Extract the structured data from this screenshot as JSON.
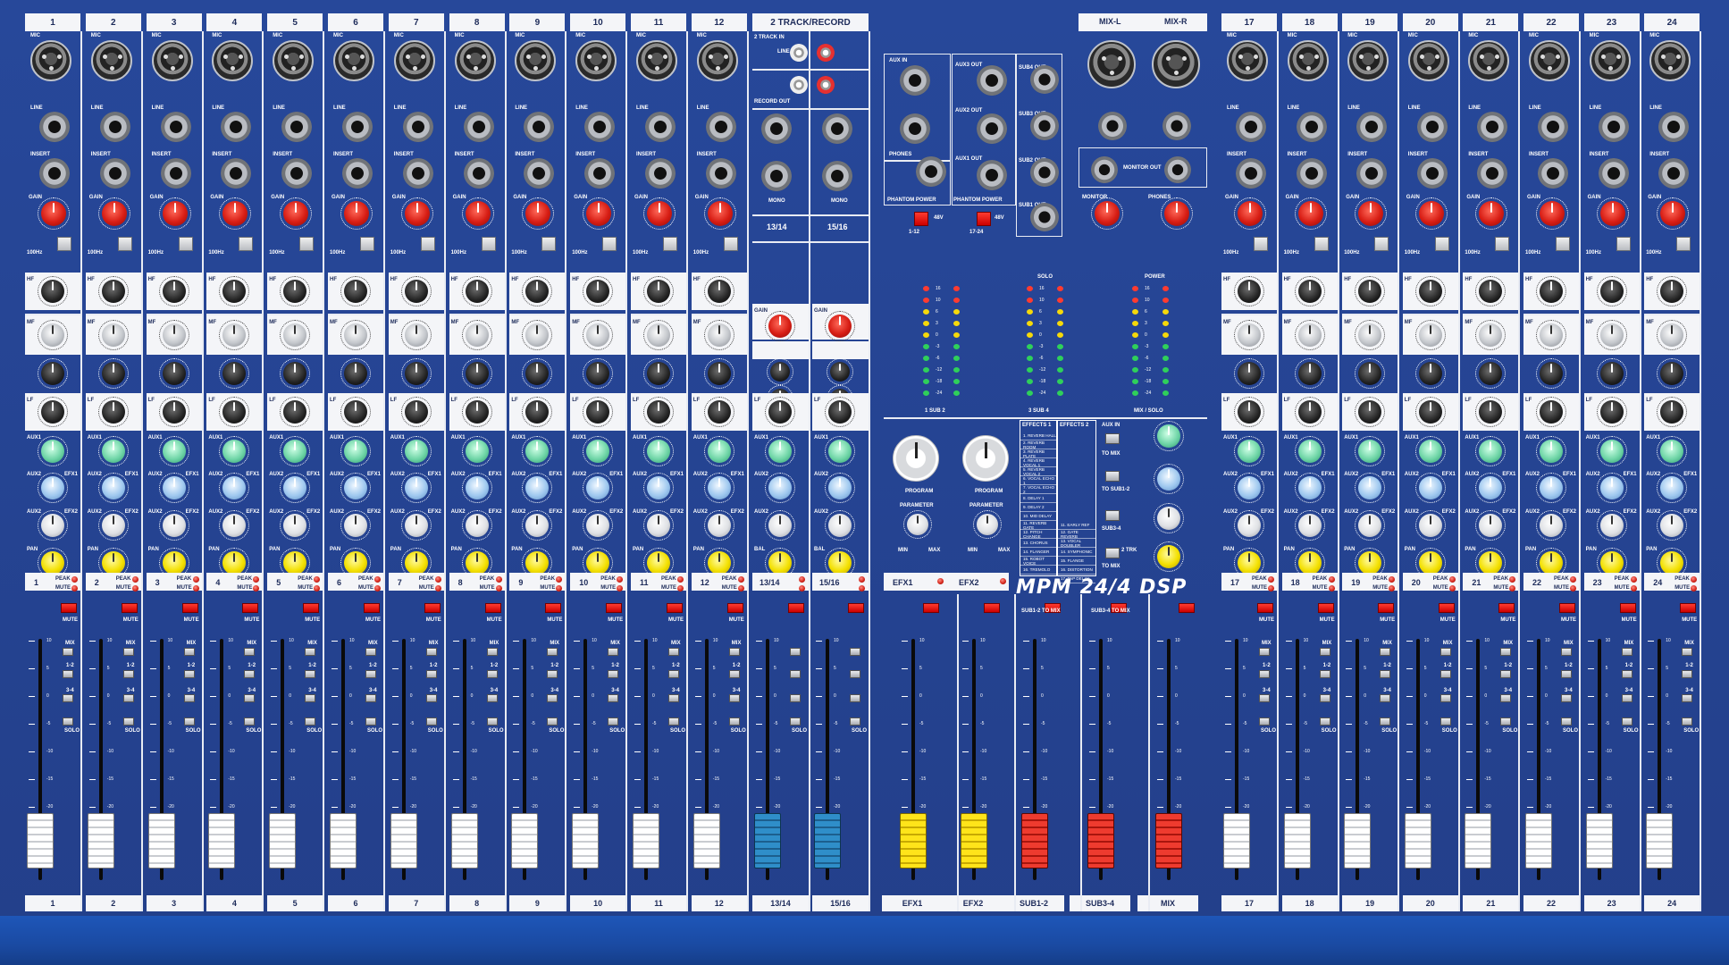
{
  "mixer": {
    "brand_logo": "MPM 24/4 DSP",
    "mono_channels": [
      "1",
      "2",
      "3",
      "4",
      "5",
      "6",
      "7",
      "8",
      "9",
      "10",
      "11",
      "12",
      "17",
      "18",
      "19",
      "20",
      "21",
      "22",
      "23",
      "24"
    ],
    "stereo_channels": [
      "13/14",
      "15/16"
    ],
    "two_track_label": "2 TRACK/RECORD",
    "two_track_in": "2 TRACK IN",
    "record_out": "RECORD OUT",
    "mono_label": "MONO",
    "mix_l": "MIX-L",
    "mix_r": "MIX-R",
    "master_labels": [
      "EFX1",
      "EFX2",
      "SUB1-2",
      "SUB3-4",
      "MIX"
    ],
    "labels": {
      "mic": "MIC",
      "line": "LINE",
      "insert": "INSERT",
      "gain": "GAIN",
      "hf": "HF",
      "mf": "MF",
      "lf": "LF",
      "aux1": "AUX1",
      "aux2": "AUX2",
      "efx1": "EFX1",
      "efx2": "EFX2",
      "pan": "PAN",
      "bal": "BAL",
      "peak": "PEAK",
      "mute": "MUTE",
      "mix": "MIX",
      "one_two": "1-2",
      "three_four": "3-4",
      "solo": "SOLO",
      "hz100": "100Hz",
      "aux_in": "AUX IN",
      "phones": "PHONES",
      "phantom": "PHANTOM POWER",
      "v48": "48V",
      "ch1_12": "1-12",
      "ch17_24": "17-24",
      "aux3_out": "AUX3 OUT",
      "aux2_out": "AUX2 OUT",
      "aux1_out": "AUX1 OUT",
      "sub4_out": "SUB4 OUT",
      "sub3_out": "SUB3 OUT",
      "sub2_out": "SUB2 OUT",
      "sub1_out": "SUB1 OUT",
      "monitor": "MONITOR",
      "monitor_out": "MONITOR OUT",
      "program": "PROGRAM",
      "parameter": "PARAMETER",
      "min": "MIN",
      "max": "MAX",
      "effects1": "EFFECTS 1",
      "effects2": "EFFECTS 2",
      "to_mix": "TO MIX",
      "to_sub": "TO SUB1-2",
      "sub34": "SUB3-4",
      "two_tr": "2 TRK",
      "sub12_to_mix": "SUB1-2 TO MIX",
      "sub34_to_mix": "SUB3-4 TO MIX",
      "solo_meter": "SOLO",
      "power": "POWER",
      "sub12": "1 SUB 2",
      "sub34m": "3 SUB 4",
      "mix_solo": "MIX / SOLO"
    },
    "meter_scale": [
      "16",
      "10",
      "6",
      "3",
      "0",
      "-3",
      "-6",
      "-12",
      "-18",
      "-24"
    ],
    "fader_scale": [
      "10",
      "5",
      "0",
      "-5",
      "-10",
      "-15",
      "-20",
      "-30",
      "-∞"
    ],
    "effects_list": [
      "1. REVERB HALL",
      "2. REVERB ROOM",
      "3. REVERB PLATE",
      "4. REVERB VOCAL 1",
      "5. REVERB VOCAL 2",
      "6. VOCAL ECHO 1",
      "7. VOCAL ECHO 2",
      "8. DELAY 1",
      "9. DELAY 2",
      "10. MID DELAY",
      "11. REVERB GATE",
      "12. PITCH CHANGE",
      "13. CHORUS",
      "14. FLANGER",
      "15. ROBOT VOICE",
      "16. TREMOLO"
    ],
    "effects_list2": [
      "11. EARLY REF",
      "12. GATE REVERB",
      "13. VOCAL DOUBLER",
      "14. SYMPHONIC",
      "15. FLANGE",
      "16. DISTORTION",
      "17. TAP DELAY"
    ],
    "colors": {
      "panel": "#27489a",
      "accent_red": "#d71d14",
      "pan_yellow": "#f3e000"
    }
  }
}
